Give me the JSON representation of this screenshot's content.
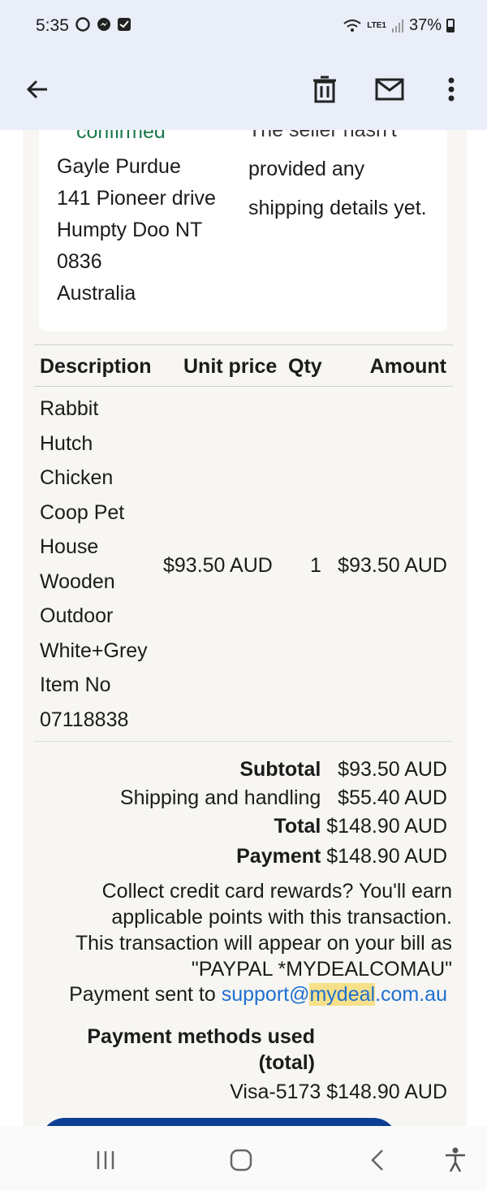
{
  "status_bar": {
    "time": "5:35",
    "battery": "37%",
    "network": "LTE1"
  },
  "app_bar": {
    "back_icon": "arrow-left-icon",
    "delete_icon": "trash-icon",
    "mail_icon": "mail-icon",
    "more_icon": "more-vert-icon"
  },
  "shipping": {
    "status": "confirmed",
    "note_top": "The seller hasn't",
    "address": [
      "Gayle Purdue",
      "141 Pioneer drive",
      "Humpty Doo NT",
      "0836",
      "Australia"
    ],
    "note": "provided any shipping details yet."
  },
  "table": {
    "headers": {
      "description": "Description",
      "unit_price": "Unit price",
      "qty": "Qty",
      "amount": "Amount"
    },
    "item": {
      "description": [
        "Rabbit",
        "Hutch",
        "Chicken",
        "Coop Pet",
        "House",
        "Wooden",
        "Outdoor",
        "White+Grey",
        "Item No",
        "07118838"
      ],
      "unit_price": "$93.50 AUD",
      "qty": "1",
      "amount": "$93.50 AUD"
    }
  },
  "totals": {
    "subtotal_label": "Subtotal",
    "subtotal_value": "$93.50 AUD",
    "shipping_label": "Shipping and handling",
    "shipping_value": "$55.40 AUD",
    "total_label": "Total",
    "total_value": "$148.90 AUD",
    "payment_label": "Payment",
    "payment_value": "$148.90 AUD"
  },
  "rewards": {
    "line1": "Collect credit card rewards? You'll earn",
    "line2": "applicable points with this transaction.",
    "line3": "This transaction will appear on your bill as",
    "line4": "\"PAYPAL *MYDEALCOMAU\""
  },
  "sent_to": {
    "prefix": "Payment sent to ",
    "link_part1": "support@",
    "link_highlight": "mydeal",
    "link_part2": ".com.au"
  },
  "payment_methods": {
    "title_line1": "Payment methods used",
    "title_line2": "(total)",
    "card": "Visa-5173",
    "amount": "$148.90 AUD"
  },
  "nav_bar": {
    "recents_icon": "recents-icon",
    "home_icon": "home-icon",
    "back_icon": "back-chevron-icon",
    "accessibility_icon": "accessibility-icon"
  }
}
